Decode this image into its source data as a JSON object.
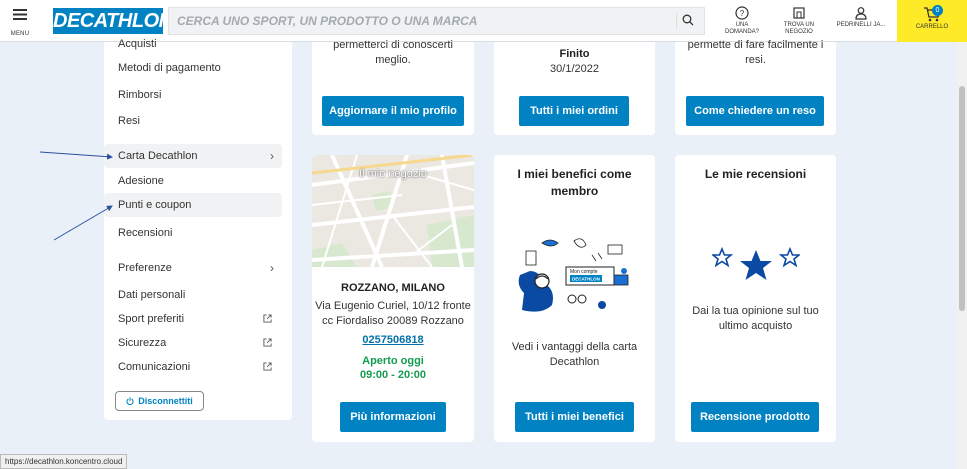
{
  "header": {
    "menu_label": "MENU",
    "logo_text": "DECATHLON",
    "search_placeholder": "CERCA UNO SPORT, UN PRODOTTO O UNA MARCA",
    "help_label": "UNA DOMANDA?",
    "store_label_1": "TROVA UN",
    "store_label_2": "NEGOZIO",
    "account_label": "PEDRINELLI JA...",
    "cart_label": "CARRELLO",
    "cart_count": "0"
  },
  "sidebar": {
    "items": [
      {
        "label": "Acquisti"
      },
      {
        "label": "Metodi di pagamento"
      },
      {
        "label": "Rimborsi"
      },
      {
        "label": "Resi"
      },
      {
        "label": "Carta Decathlon"
      },
      {
        "label": "Adesione"
      },
      {
        "label": "Punti e coupon"
      },
      {
        "label": "Recensioni"
      },
      {
        "label": "Preferenze"
      },
      {
        "label": "Dati personali"
      },
      {
        "label": "Sport preferiti"
      },
      {
        "label": "Sicurezza"
      },
      {
        "label": "Comunicazioni"
      }
    ],
    "logout_label": "Disconnettiti"
  },
  "cards": {
    "profile": {
      "text_1": "permetterci di conoscerti",
      "text_2": "meglio.",
      "button": "Aggiornare il mio profilo"
    },
    "orders": {
      "status": "Finito",
      "date": "30/1/2022",
      "button": "Tutti i miei ordini"
    },
    "returns": {
      "text_1": "permette di fare facilmente i",
      "text_2": "resi.",
      "button": "Come chiedere un reso"
    },
    "store": {
      "map_label": "Il mio negozio",
      "name": "ROZZANO, MILANO",
      "address_1": "Via Eugenio Curiel, 10/12 fronte",
      "address_2": "cc Fiordaliso 20089 Rozzano",
      "phone": "0257506818",
      "open_label": "Aperto oggi",
      "hours": "09:00 - 20:00",
      "button": "Più informazioni"
    },
    "benefits": {
      "title_1": "I miei benefici come",
      "title_2": "membro",
      "illustration_caption": "Mon compte",
      "illustration_brand": "DECATHLON",
      "text_1": "Vedi i vantaggi della carta",
      "text_2": "Decathlon",
      "button": "Tutti i miei benefici"
    },
    "reviews": {
      "title": "Le mie recensioni",
      "text_1": "Dai la tua opinione sul tuo",
      "text_2": "ultimo acquisto",
      "button": "Recensione prodotto"
    }
  },
  "status_url": "https://decathlon.koncentro.cloud",
  "colors": {
    "brand": "#0082c3",
    "cart": "#ffea28",
    "open": "#149b52"
  }
}
